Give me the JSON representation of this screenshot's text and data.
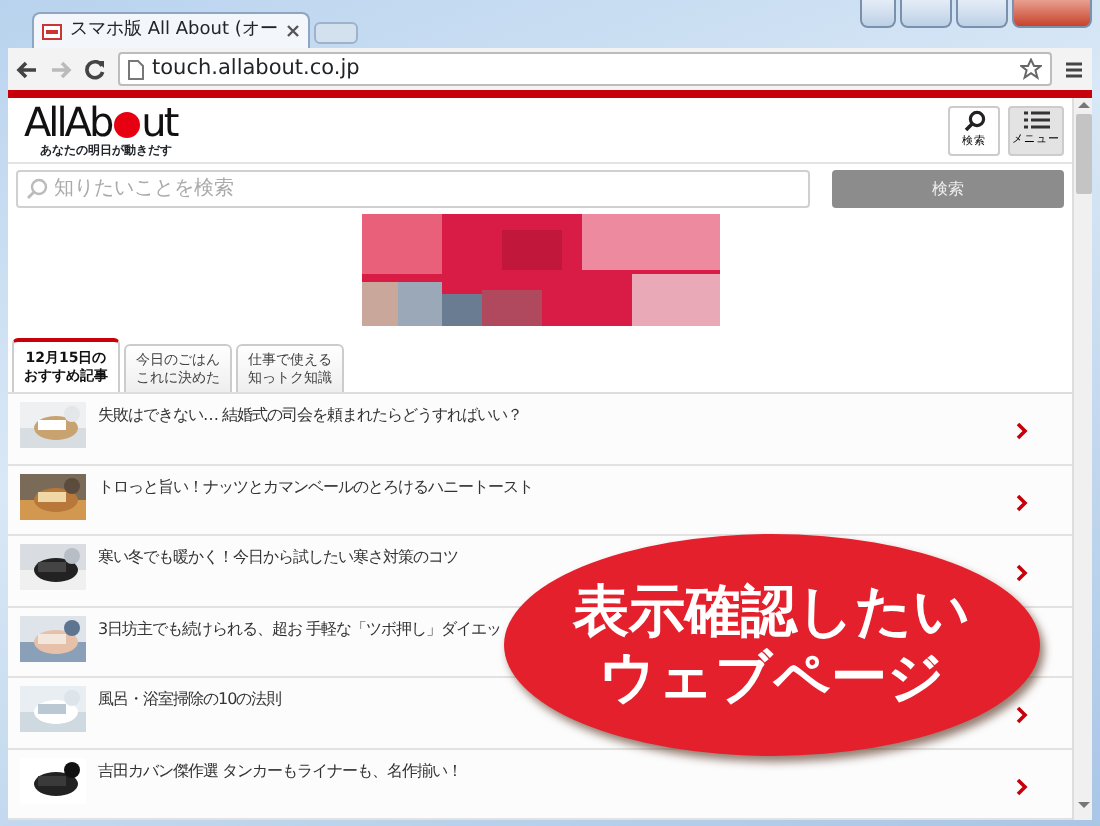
{
  "browser": {
    "tab_title": "スマホ版 All About (オー",
    "url": "touch.allabout.co.jp"
  },
  "header": {
    "logo_parts": [
      "AllAb",
      "ut"
    ],
    "tagline": "あなたの明日が動きだす",
    "buttons": [
      {
        "kind": "search",
        "label": "検索"
      },
      {
        "kind": "menu",
        "label": "メニュー"
      }
    ]
  },
  "search": {
    "placeholder": "知りたいことを検索",
    "button": "検索"
  },
  "tabs": [
    {
      "label": "12月15日のおすすめ記事",
      "selected": true
    },
    {
      "label": "今日のごはんこれに決めた",
      "selected": false
    },
    {
      "label": "仕事で使える知っトク知識",
      "selected": false
    }
  ],
  "articles": [
    {
      "title": "失敗はできない… 結婚式の司会を頼まれたらどうすればいい？",
      "chevron": true
    },
    {
      "title": "トロっと旨い！ナッツとカマンベールのとろけるハニートースト",
      "chevron": true
    },
    {
      "title": "寒い冬でも暖かく！今日から試したい寒さ対策のコツ",
      "chevron": true
    },
    {
      "title": "3日坊主でも続けられる、超お 手軽な「ツボ押し」ダイエッ",
      "chevron": false
    },
    {
      "title": "風呂・浴室掃除の10の法則",
      "chevron": true
    },
    {
      "title": "吉田カバン傑作選 タンカーもライナーも、名作揃い！",
      "chevron": true
    }
  ],
  "callout": {
    "lines": [
      "表示確認したい",
      "ウェブページ"
    ]
  }
}
